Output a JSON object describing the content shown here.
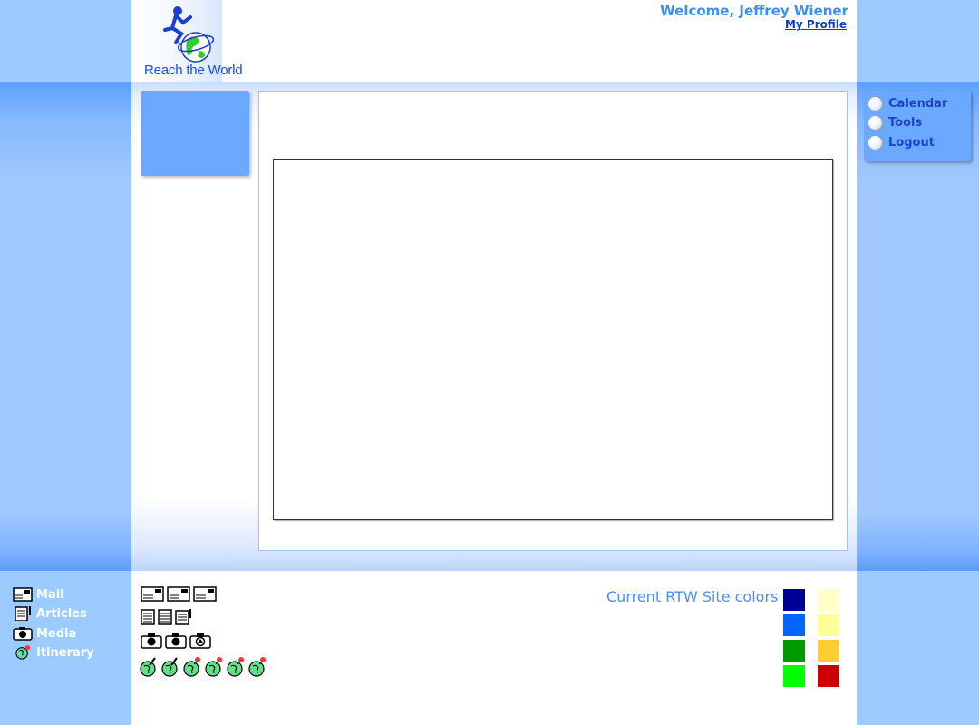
{
  "header": {
    "logo_text": "Reach the World",
    "welcome": "Welcome, Jeffrey Wiener",
    "profile_link": "My Profile"
  },
  "right_menu": {
    "items": [
      {
        "label": "Calendar",
        "icon": "radio-bullet"
      },
      {
        "label": "Tools",
        "icon": "radio-bullet"
      },
      {
        "label": "Logout",
        "icon": "radio-bullet"
      }
    ]
  },
  "legend": {
    "items": [
      {
        "label": "Mail",
        "icon": "mail-icon"
      },
      {
        "label": "Articles",
        "icon": "article-icon"
      },
      {
        "label": "Media",
        "icon": "camera-icon"
      },
      {
        "label": "Itinerary",
        "icon": "globe-icon"
      }
    ]
  },
  "icon_sets": {
    "mail": [
      "mail-icon",
      "mail-icon",
      "mail-icon"
    ],
    "articles": [
      "article-icon",
      "article-icon",
      "article-edit-icon"
    ],
    "media": [
      "camera-icon",
      "camera-icon",
      "camera-upload-icon"
    ],
    "itinerary": [
      "globe-pin-icon",
      "globe-pin-icon",
      "globe-marker-icon",
      "globe-marker-icon",
      "globe-marker-icon",
      "globe-marker-icon"
    ]
  },
  "site_colors": {
    "title": "Current RTW Site colors",
    "swatches": [
      "#000099",
      "#ffffcc",
      "#0066ff",
      "#ffff99",
      "#009900",
      "#ffcc33",
      "#00ff00",
      "#cc0000"
    ]
  }
}
